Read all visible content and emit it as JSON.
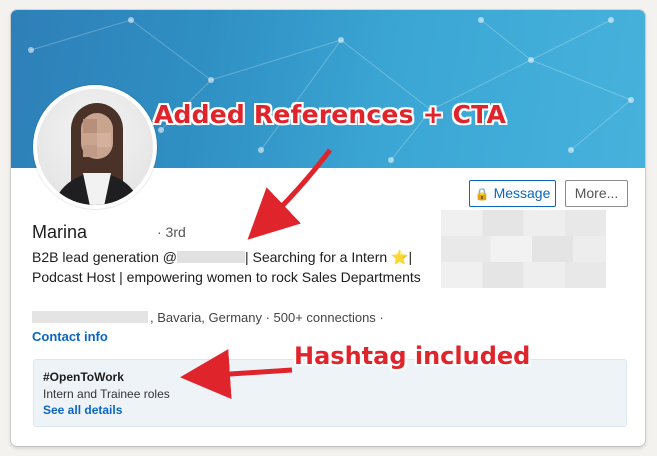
{
  "annotations": {
    "references_cta": "Added References + CTA",
    "hashtag": "Hashtag included",
    "color": "#e0242b"
  },
  "profile": {
    "name": "Marina",
    "degree": "· 3rd",
    "headline_start": "B2B lead generation @",
    "headline_end": "| Searching for a Intern ⭐️| Podcast Host | empowering women to rock Sales Departments",
    "location": ", Bavaria, Germany  ·  500+ connections  ·",
    "contact_info": "Contact info"
  },
  "actions": {
    "message_label": "Message",
    "more_label": "More..."
  },
  "open_to_work": {
    "title": "#OpenToWork",
    "roles": "Intern and Trainee roles",
    "link": "See all details"
  },
  "colors": {
    "link_blue": "#0a66c2",
    "banner": "#2f8fc3"
  }
}
